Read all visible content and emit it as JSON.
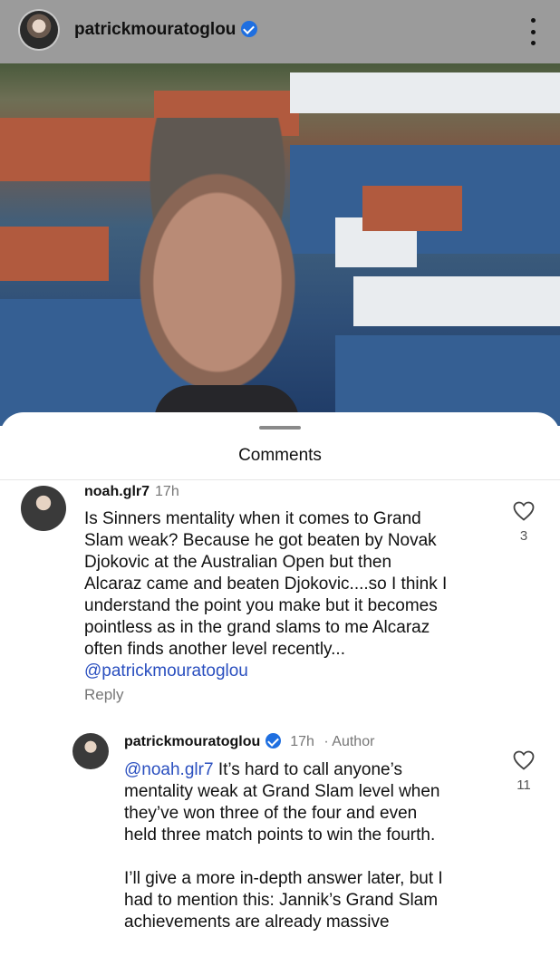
{
  "header": {
    "username": "patrickmouratoglou"
  },
  "sheet": {
    "title": "Comments"
  },
  "comments": [
    {
      "username": "noah.glr7",
      "time": "17h",
      "lines": [
        "Is Sinners mentality when it comes to Grand",
        "Slam weak? Because he got beaten by Novak",
        "Djokovic at the Australian Open but then",
        "Alcaraz came and beaten Djokovic....so I think I",
        "understand the point you make but it becomes",
        "pointless as in the grand slams to me Alcaraz",
        "often finds another level recently..."
      ],
      "mention": "@patrickmouratoglou",
      "reply_label": "Reply",
      "likes": "3"
    },
    {
      "username": "patrickmouratoglou",
      "time": "17h",
      "author_label": "Author",
      "mention": "@noah.glr7",
      "first_line_rest": "It’s hard to call anyone’s",
      "lines": [
        "mentality weak at Grand Slam level when",
        "they’ve won three of the four and even",
        "held three match points to win the fourth.",
        "",
        "I’ll give a more in-depth answer later, but I",
        "had to mention this: Jannik’s Grand Slam",
        "achievements are already massive"
      ],
      "likes": "11"
    }
  ],
  "icons": {
    "like": "heart-icon",
    "more": "more-vertical-icon",
    "verified": "verified-badge-icon"
  },
  "colors": {
    "mention": "#2a4fbf",
    "verified": "#1f6fe0"
  }
}
